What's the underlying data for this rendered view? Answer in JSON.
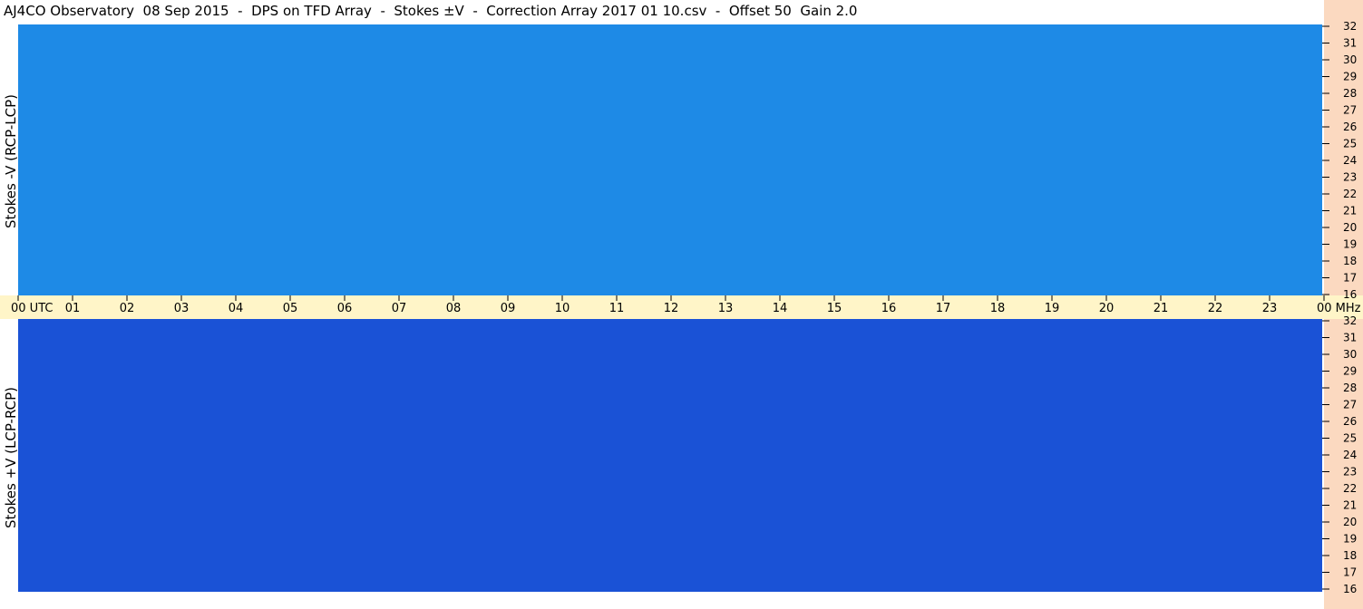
{
  "title": "AJ4CO Observatory  08 Sep 2015  -  DPS on TFD Array  -  Stokes ±V  -  Correction Array 2017 01 10.csv  -  Offset 50  Gain 2.0",
  "colors": {
    "upper_background": "#1e8ae6",
    "lower_background": "#1a52d6",
    "time_strip": "#fff5c8",
    "freq_strip": "#fbd9c0"
  },
  "chart_data": [
    {
      "type": "heatmap",
      "ylabel": "Stokes -V (RCP-LCP)",
      "ylim": [
        16,
        32
      ],
      "y_ticks": [
        "32",
        "31",
        "30",
        "29",
        "28",
        "27",
        "26",
        "25",
        "24",
        "23",
        "22",
        "21",
        "20",
        "19",
        "18",
        "17",
        "16"
      ],
      "grid": false
    },
    {
      "type": "heatmap",
      "ylabel": "Stokes +V (LCP-RCP)",
      "ylim": [
        16,
        32
      ],
      "y_ticks": [
        "32",
        "31",
        "30",
        "29",
        "28",
        "27",
        "26",
        "25",
        "24",
        "23",
        "22",
        "21",
        "20",
        "19",
        "18",
        "17",
        "16"
      ],
      "grid": false
    }
  ],
  "time_axis": {
    "ticks": [
      "00",
      "01",
      "02",
      "03",
      "04",
      "05",
      "06",
      "07",
      "08",
      "09",
      "10",
      "11",
      "12",
      "13",
      "14",
      "15",
      "16",
      "17",
      "18",
      "19",
      "20",
      "21",
      "22",
      "23",
      "00"
    ],
    "start_unit": "UTC",
    "freq_unit": "MHz"
  }
}
